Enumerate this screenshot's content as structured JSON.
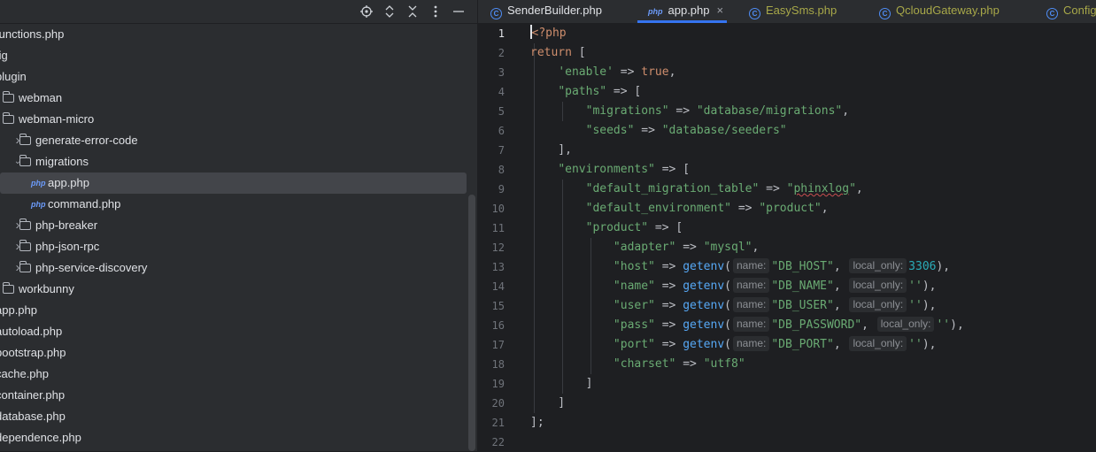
{
  "project": {
    "toolbar_icons": [
      "locate-icon",
      "expand-collapse-icon",
      "collapse-all-icon",
      "more-icon",
      "hide-icon"
    ],
    "tree": [
      {
        "label": "functions.php",
        "type": "file",
        "indent": 0
      },
      {
        "label": "fig",
        "type": "file",
        "indent": 0
      },
      {
        "label": "plugin",
        "type": "file",
        "indent": 0
      },
      {
        "label": "webman",
        "type": "folder",
        "indent": 1
      },
      {
        "label": "webman-micro",
        "type": "folder",
        "indent": 1
      },
      {
        "label": "generate-error-code",
        "type": "folder",
        "indent": 2,
        "collapsed": true
      },
      {
        "label": "migrations",
        "type": "folder",
        "indent": 2,
        "expanded": true
      },
      {
        "label": "app.php",
        "type": "php",
        "indent": 3,
        "selected": true
      },
      {
        "label": "command.php",
        "type": "php",
        "indent": 3
      },
      {
        "label": "php-breaker",
        "type": "folder",
        "indent": 2,
        "collapsed": true
      },
      {
        "label": "php-json-rpc",
        "type": "folder",
        "indent": 2,
        "collapsed": true
      },
      {
        "label": "php-service-discovery",
        "type": "folder",
        "indent": 2,
        "collapsed": true
      },
      {
        "label": "workbunny",
        "type": "folder",
        "indent": 1
      },
      {
        "label": "app.php",
        "type": "file",
        "indent": 0
      },
      {
        "label": "autoload.php",
        "type": "file",
        "indent": 0
      },
      {
        "label": "bootstrap.php",
        "type": "file",
        "indent": 0
      },
      {
        "label": "cache.php",
        "type": "file",
        "indent": 0
      },
      {
        "label": "container.php",
        "type": "file",
        "indent": 0
      },
      {
        "label": "database.php",
        "type": "file",
        "indent": 0
      },
      {
        "label": "dependence.php",
        "type": "file",
        "indent": 0
      }
    ],
    "php_badge": "php"
  },
  "tabs": [
    {
      "label": "SenderBuilder.php",
      "icon": "class-icon",
      "color": "#dfe1e5"
    },
    {
      "label": "app.php",
      "icon": "php-icon",
      "active": true,
      "color": "#dfe1e5"
    },
    {
      "label": "EasySms.php",
      "icon": "class-icon",
      "color": "#a8a849"
    },
    {
      "label": "QcloudGateway.php",
      "icon": "class-icon",
      "color": "#a8a849"
    },
    {
      "label": "Config",
      "icon": "class-icon",
      "color": "#a8a849"
    }
  ],
  "tab_icon_letter": "C",
  "tab_close": "×",
  "editor": {
    "line_numbers": [
      "1",
      "2",
      "3",
      "4",
      "5",
      "6",
      "7",
      "8",
      "9",
      "10",
      "11",
      "12",
      "13",
      "14",
      "15",
      "16",
      "17",
      "18",
      "19",
      "20",
      "21",
      "22"
    ],
    "current_line": 1,
    "lines": [
      [
        {
          "t": "<?php",
          "c": "kw"
        }
      ],
      [
        {
          "t": "return",
          "c": "kw"
        },
        {
          "t": " [",
          "c": "plain"
        }
      ],
      [
        {
          "t": "    ",
          "c": "plain"
        },
        {
          "t": "'enable'",
          "c": "str"
        },
        {
          "t": " => ",
          "c": "plain"
        },
        {
          "t": "true",
          "c": "kw"
        },
        {
          "t": ",",
          "c": "plain"
        }
      ],
      [
        {
          "t": "    ",
          "c": "plain"
        },
        {
          "t": "\"paths\"",
          "c": "str"
        },
        {
          "t": " => [",
          "c": "plain"
        }
      ],
      [
        {
          "t": "        ",
          "c": "plain"
        },
        {
          "t": "\"migrations\"",
          "c": "str"
        },
        {
          "t": " => ",
          "c": "plain"
        },
        {
          "t": "\"database/migrations\"",
          "c": "str"
        },
        {
          "t": ",",
          "c": "plain"
        }
      ],
      [
        {
          "t": "        ",
          "c": "plain"
        },
        {
          "t": "\"seeds\"",
          "c": "str"
        },
        {
          "t": " => ",
          "c": "plain"
        },
        {
          "t": "\"database/seeders\"",
          "c": "str"
        }
      ],
      [
        {
          "t": "    ],",
          "c": "plain"
        }
      ],
      [
        {
          "t": "    ",
          "c": "plain"
        },
        {
          "t": "\"environments\"",
          "c": "str"
        },
        {
          "t": " => [",
          "c": "plain"
        }
      ],
      [
        {
          "t": "        ",
          "c": "plain"
        },
        {
          "t": "\"default_migration_table\"",
          "c": "str"
        },
        {
          "t": " => ",
          "c": "plain"
        },
        {
          "t": "\"",
          "c": "str"
        },
        {
          "t": "phinxlog",
          "c": "str sq"
        },
        {
          "t": "\"",
          "c": "str"
        },
        {
          "t": ",",
          "c": "plain"
        }
      ],
      [
        {
          "t": "        ",
          "c": "plain"
        },
        {
          "t": "\"default_environment\"",
          "c": "str"
        },
        {
          "t": " => ",
          "c": "plain"
        },
        {
          "t": "\"product\"",
          "c": "str"
        },
        {
          "t": ",",
          "c": "plain"
        }
      ],
      [
        {
          "t": "        ",
          "c": "plain"
        },
        {
          "t": "\"product\"",
          "c": "str"
        },
        {
          "t": " => [",
          "c": "plain"
        }
      ],
      [
        {
          "t": "            ",
          "c": "plain"
        },
        {
          "t": "\"adapter\"",
          "c": "str"
        },
        {
          "t": " => ",
          "c": "plain"
        },
        {
          "t": "\"mysql\"",
          "c": "str"
        },
        {
          "t": ",",
          "c": "plain"
        }
      ],
      [
        {
          "t": "            ",
          "c": "plain"
        },
        {
          "t": "\"host\"",
          "c": "str"
        },
        {
          "t": " => ",
          "c": "plain"
        },
        {
          "t": "getenv",
          "c": "fn"
        },
        {
          "t": "(",
          "c": "plain"
        },
        {
          "t": "name:",
          "c": "hint"
        },
        {
          "t": "\"DB_HOST\"",
          "c": "str"
        },
        {
          "t": ", ",
          "c": "plain"
        },
        {
          "t": "local_only:",
          "c": "hint"
        },
        {
          "t": "3306",
          "c": "num"
        },
        {
          "t": "),",
          "c": "plain"
        }
      ],
      [
        {
          "t": "            ",
          "c": "plain"
        },
        {
          "t": "\"name\"",
          "c": "str"
        },
        {
          "t": " => ",
          "c": "plain"
        },
        {
          "t": "getenv",
          "c": "fn"
        },
        {
          "t": "(",
          "c": "plain"
        },
        {
          "t": "name:",
          "c": "hint"
        },
        {
          "t": "\"DB_NAME\"",
          "c": "str"
        },
        {
          "t": ", ",
          "c": "plain"
        },
        {
          "t": "local_only:",
          "c": "hint"
        },
        {
          "t": "''",
          "c": "str"
        },
        {
          "t": "),",
          "c": "plain"
        }
      ],
      [
        {
          "t": "            ",
          "c": "plain"
        },
        {
          "t": "\"user\"",
          "c": "str"
        },
        {
          "t": " => ",
          "c": "plain"
        },
        {
          "t": "getenv",
          "c": "fn"
        },
        {
          "t": "(",
          "c": "plain"
        },
        {
          "t": "name:",
          "c": "hint"
        },
        {
          "t": "\"DB_USER\"",
          "c": "str"
        },
        {
          "t": ", ",
          "c": "plain"
        },
        {
          "t": "local_only:",
          "c": "hint"
        },
        {
          "t": "''",
          "c": "str"
        },
        {
          "t": "),",
          "c": "plain"
        }
      ],
      [
        {
          "t": "            ",
          "c": "plain"
        },
        {
          "t": "\"pass\"",
          "c": "str"
        },
        {
          "t": " => ",
          "c": "plain"
        },
        {
          "t": "getenv",
          "c": "fn"
        },
        {
          "t": "(",
          "c": "plain"
        },
        {
          "t": "name:",
          "c": "hint"
        },
        {
          "t": "\"DB_PASSWORD\"",
          "c": "str"
        },
        {
          "t": ", ",
          "c": "plain"
        },
        {
          "t": "local_only:",
          "c": "hint"
        },
        {
          "t": "''",
          "c": "str"
        },
        {
          "t": "),",
          "c": "plain"
        }
      ],
      [
        {
          "t": "            ",
          "c": "plain"
        },
        {
          "t": "\"port\"",
          "c": "str"
        },
        {
          "t": " => ",
          "c": "plain"
        },
        {
          "t": "getenv",
          "c": "fn"
        },
        {
          "t": "(",
          "c": "plain"
        },
        {
          "t": "name:",
          "c": "hint"
        },
        {
          "t": "\"DB_PORT\"",
          "c": "str"
        },
        {
          "t": ", ",
          "c": "plain"
        },
        {
          "t": "local_only:",
          "c": "hint"
        },
        {
          "t": "''",
          "c": "str"
        },
        {
          "t": "),",
          "c": "plain"
        }
      ],
      [
        {
          "t": "            ",
          "c": "plain"
        },
        {
          "t": "\"charset\"",
          "c": "str"
        },
        {
          "t": " => ",
          "c": "plain"
        },
        {
          "t": "\"utf8\"",
          "c": "str"
        }
      ],
      [
        {
          "t": "        ]",
          "c": "plain"
        }
      ],
      [
        {
          "t": "    ]",
          "c": "plain"
        }
      ],
      [
        {
          "t": "];",
          "c": "plain"
        }
      ],
      [
        {
          "t": "",
          "c": "plain"
        }
      ]
    ]
  },
  "colors": {
    "accent": "#3574f0",
    "keyword": "#cf8e6d",
    "string": "#6aab73",
    "number": "#2aacb8",
    "function": "#56a8f5"
  }
}
